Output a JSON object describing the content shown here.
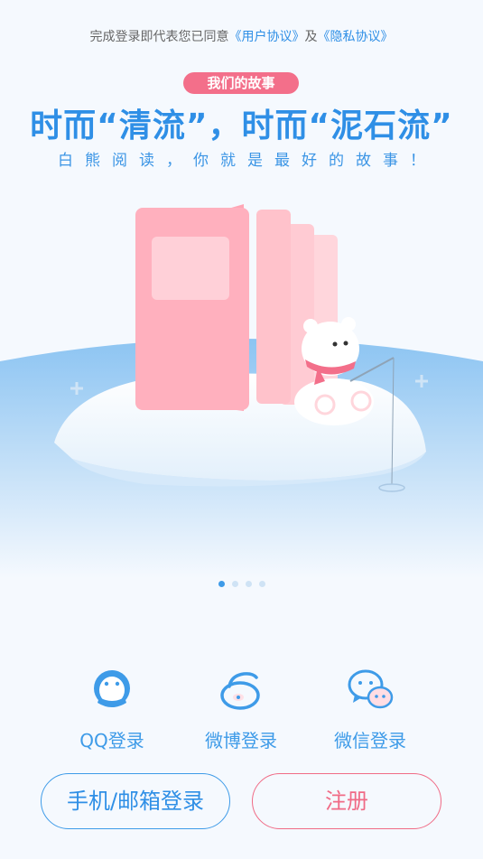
{
  "agreement": {
    "prefix": "完成登录即代表您已同意",
    "user_agreement": "《用户协议》",
    "conjunction": "及",
    "privacy_agreement": "《隐私协议》"
  },
  "story": {
    "badge": "我们的故事",
    "headline": "时而“清流”，时而“泥石流”",
    "subline": "白熊阅读，你就是最好的故事！"
  },
  "carousel": {
    "count": 4,
    "active_index": 0
  },
  "social_login": [
    {
      "label": "QQ登录",
      "icon": "qq-icon"
    },
    {
      "label": "微博登录",
      "icon": "weibo-icon"
    },
    {
      "label": "微信登录",
      "icon": "wechat-icon"
    }
  ],
  "buttons": {
    "phone_email_login": "手机/邮箱登录",
    "register": "注册"
  },
  "colors": {
    "accent_blue": "#2f8fe6",
    "accent_pink": "#f06b86",
    "background": "#f5f9fe"
  }
}
